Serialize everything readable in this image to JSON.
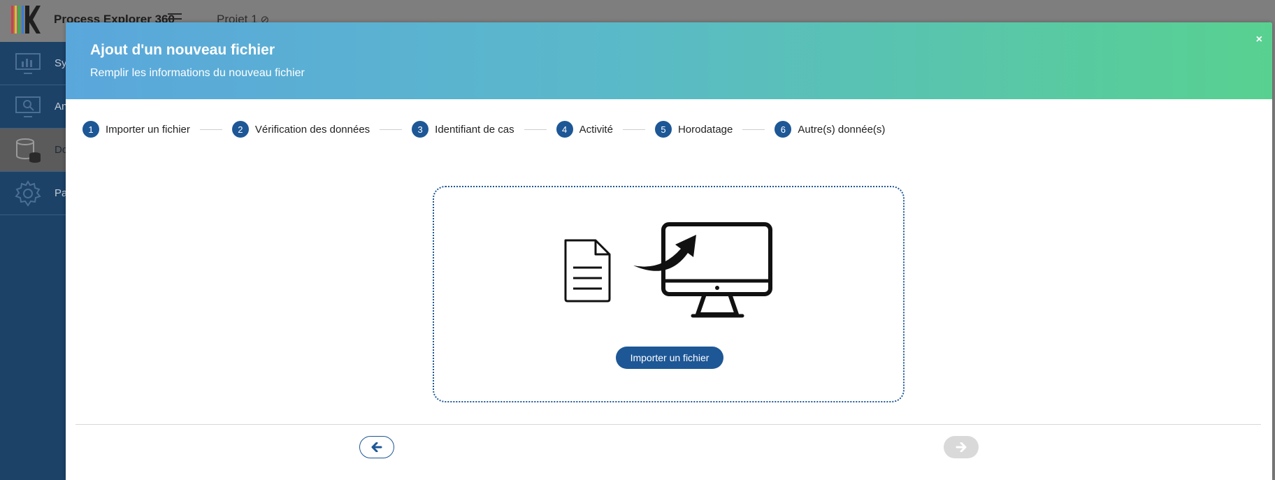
{
  "app": {
    "title": "Process Explorer 360",
    "project": "Projet 1"
  },
  "sidebar": {
    "items": [
      {
        "label": "Sy",
        "icon": "monitor-chart-icon"
      },
      {
        "label": "An",
        "icon": "monitor-search-icon"
      },
      {
        "label": "Do",
        "icon": "database-icon",
        "active": true
      },
      {
        "label": "Pa",
        "icon": "gear-icon"
      }
    ]
  },
  "modal": {
    "title": "Ajout d'un nouveau fichier",
    "subtitle": "Remplir les informations du nouveau fichier",
    "close_label": "×",
    "steps": [
      {
        "num": "1",
        "label": "Importer un fichier"
      },
      {
        "num": "2",
        "label": "Vérification des données"
      },
      {
        "num": "3",
        "label": "Identifiant de cas"
      },
      {
        "num": "4",
        "label": "Activité"
      },
      {
        "num": "5",
        "label": "Horodatage"
      },
      {
        "num": "6",
        "label": "Autre(s) donnée(s)"
      }
    ],
    "import_button": "Importer un fichier"
  },
  "colors": {
    "primary": "#1d5796",
    "header_gradient_start": "#5aa7dc",
    "header_gradient_end": "#58d190",
    "sidebar": "#1c4268"
  }
}
